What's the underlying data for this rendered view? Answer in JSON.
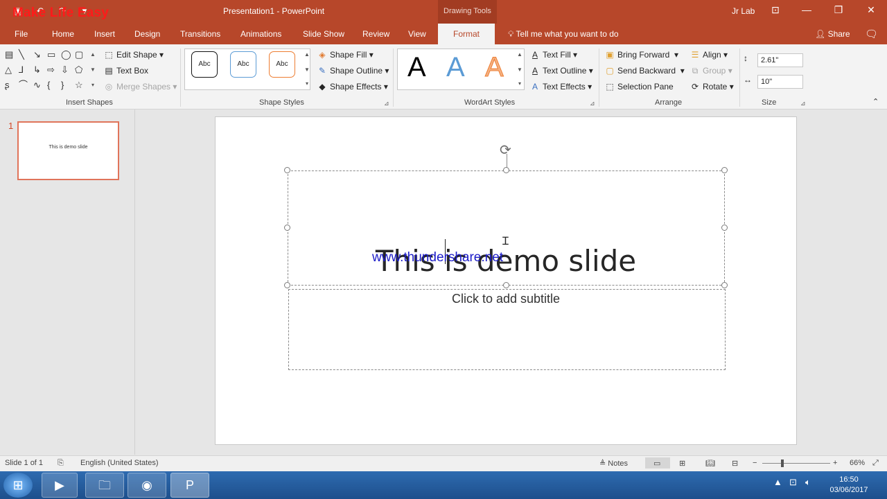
{
  "window": {
    "watermark_top": "Make Life Easy",
    "doc_title": "Presentation1  -  PowerPoint",
    "context_tab": "Drawing Tools",
    "user": "Jr Lab"
  },
  "tabs": [
    "File",
    "Home",
    "Insert",
    "Design",
    "Transitions",
    "Animations",
    "Slide Show",
    "Review",
    "View",
    "Format"
  ],
  "tell_me": "Tell me what you want to do",
  "share": "Share",
  "ribbon": {
    "insert_shapes": {
      "label": "Insert Shapes",
      "edit_shape": "Edit Shape",
      "text_box": "Text Box",
      "merge_shapes": "Merge Shapes"
    },
    "shape_styles": {
      "label": "Shape Styles",
      "style_samples": [
        "Abc",
        "Abc",
        "Abc"
      ],
      "shape_fill": "Shape Fill",
      "shape_outline": "Shape Outline",
      "shape_effects": "Shape Effects"
    },
    "wordart": {
      "label": "WordArt Styles",
      "samples": [
        "A",
        "A",
        "A"
      ],
      "text_fill": "Text Fill",
      "text_outline": "Text Outline",
      "text_effects": "Text Effects"
    },
    "arrange": {
      "label": "Arrange",
      "bring_forward": "Bring Forward",
      "send_backward": "Send Backward",
      "selection_pane": "Selection Pane",
      "align": "Align",
      "group": "Group",
      "rotate": "Rotate"
    },
    "size": {
      "label": "Size",
      "height": "2.61\"",
      "width": "10\""
    }
  },
  "thumbnails": [
    {
      "number": "1",
      "text": "This is demo slide"
    }
  ],
  "slide": {
    "title": "This is demo slide",
    "subtitle_placeholder": "Click to add subtitle",
    "watermark": "www.thundershare.net"
  },
  "status": {
    "slide_info": "Slide 1 of 1",
    "language": "English (United States)",
    "notes": "Notes",
    "zoom": "66%"
  },
  "taskbar": {
    "time": "16:50",
    "date": "03/06/2017"
  },
  "colors": {
    "accent": "#b7472a",
    "thumb_border": "#e0745a"
  }
}
